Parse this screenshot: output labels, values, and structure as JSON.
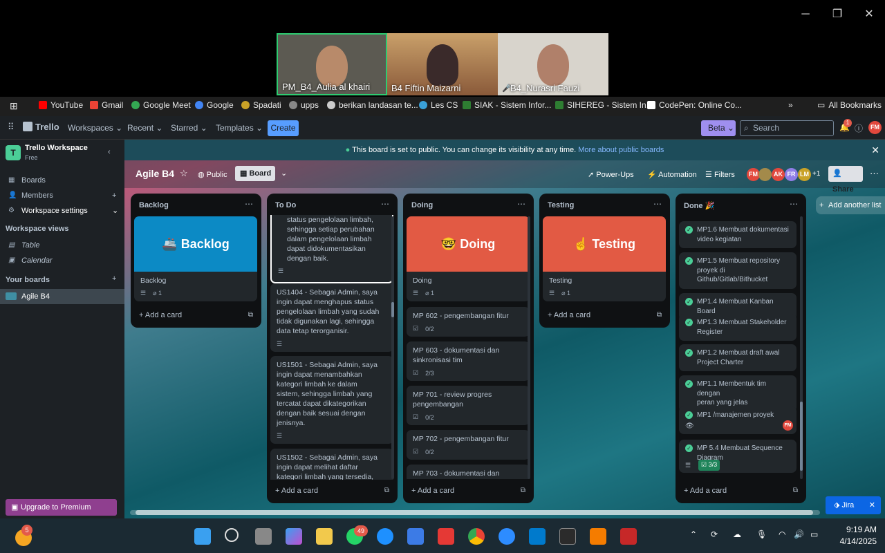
{
  "zoom": {
    "participants": [
      {
        "name": "PM_B4_Aulia al khairi"
      },
      {
        "name": "B4 Fiftin Maizarni"
      },
      {
        "name": "B4_Nurasri Fauzi"
      }
    ]
  },
  "bookmarks": [
    {
      "label": "YouTube",
      "color": "#ff0000"
    },
    {
      "label": "Gmail",
      "color": "#ea4335"
    },
    {
      "label": "Google Meet",
      "color": "#34a853"
    },
    {
      "label": "Google",
      "color": "#4285f4"
    },
    {
      "label": "Spadati",
      "color": "#c9a227"
    },
    {
      "label": "upps",
      "color": "#888888"
    },
    {
      "label": "berikan landasan te...",
      "color": "#cccccc"
    },
    {
      "label": "Les CS",
      "color": "#3aa0d8"
    },
    {
      "label": "SIAK - Sistem Infor...",
      "color": "#2e7d32"
    },
    {
      "label": "SIHEREG - Sistem In...",
      "color": "#2e7d32"
    },
    {
      "label": "CodePen: Online Co...",
      "color": "#ffffff"
    }
  ],
  "all_bookmarks": "All Bookmarks",
  "topnav": {
    "logo": "Trello",
    "workspaces": "Workspaces",
    "recent": "Recent",
    "starred": "Starred",
    "templates": "Templates",
    "create": "Create",
    "beta": "Beta",
    "search_placeholder": "Search",
    "notif_count": "1",
    "user_initials": "FM"
  },
  "sidebar": {
    "workspace_name": "Trello Workspace",
    "workspace_plan": "Free",
    "workspace_initial": "T",
    "boards": "Boards",
    "members": "Members",
    "workspace_settings": "Workspace settings",
    "workspace_views": "Workspace views",
    "table": "Table",
    "calendar": "Calendar",
    "your_boards": "Your boards",
    "board_item": "Agile B4",
    "upgrade": "Upgrade to Premium"
  },
  "banner": {
    "text": "This board is set to public. You can change its visibility at any time.",
    "link": "More about public boards"
  },
  "board_header": {
    "title": "Agile B4",
    "visibility": "Public",
    "view": "Board",
    "power_ups": "Power-Ups",
    "automation": "Automation",
    "filters": "Filters",
    "members": [
      "FM",
      "AK",
      "FR",
      "LM"
    ],
    "more_members": "+1",
    "share": "Share"
  },
  "lists": {
    "backlog": {
      "title": "Backlog",
      "cover_label": "🚢 Backlog",
      "cover_color": "#0c8ac5",
      "card_title": "Backlog",
      "attach": "1",
      "add": "Add a card"
    },
    "todo": {
      "title": "To Do",
      "cards": [
        "status pengelolaan limbah,\nsehingga setiap perubahan\ndalam pengelolaan limbah\ndapat didokumentasikan\ndengan baik.",
        "US1404 - Sebagai Admin, saya\ningin dapat menghapus status\npengelolaan limbah yang sudah\ntidak digunakan lagi, sehingga\ndata tetap terorganisir.",
        "US1501 - Sebagai Admin, saya\ningin dapat menambahkan\nkategori limbah ke dalam\nsistem, sehingga limbah yang\ntercatat dapat dikategorikan\ndengan baik sesuai dengan\njenisnya.",
        "US1502 - Sebagai Admin, saya\ningin dapat melihat daftar\nkategori limbah yang tersedia,"
      ],
      "add": "Add a card"
    },
    "doing": {
      "title": "Doing",
      "cover_label": "🤓 Doing",
      "cover_color": "#e25a44",
      "card_title": "Doing",
      "attach": "1",
      "cards": [
        {
          "title": "MP 602 - pengembangan fitur",
          "check": "0/2"
        },
        {
          "title": "MP 603 - dokumentasi dan\nsinkronisasi tim",
          "check": "2/3"
        },
        {
          "title": "MP 701 - review progres\npengembangan",
          "check": "0/2"
        },
        {
          "title": "MP 702 - pengembangan fitur",
          "check": "0/2"
        },
        {
          "title": "MP 703 - dokumentasi dan",
          "check": ""
        }
      ],
      "add": "Add a card"
    },
    "testing": {
      "title": "Testing",
      "cover_label": "☝ Testing",
      "cover_color": "#e25a44",
      "card_title": "Testing",
      "attach": "1",
      "add": "Add a card"
    },
    "done": {
      "title": "Done 🎉",
      "cards": [
        "MP1.6 Membuat dokumentasi\nvideo kegiatan",
        "MP1.5 Membuat repository\nproyek di\nGithub/Gitlab/Bithucket",
        "MP1.4 Membuat Kanban Board",
        "MP1.3 Membuat Stakeholder\nRegister",
        "MP1.2 Membuat draft awal\nProject Charter",
        "MP1.1 Membentuk tim dengan\nperan yang jelas",
        "MP1 /manajemen proyek",
        "MP 5.4 Membuat Sequence\nDiagram"
      ],
      "last_check": "3/3",
      "member": "FM",
      "add": "Add a card"
    }
  },
  "add_another_list": "Add another list",
  "jira": "Jira",
  "taskbar": {
    "weather_badge": "5",
    "whatsapp_badge": "49",
    "time": "9:19 AM",
    "date": "4/14/2025"
  }
}
